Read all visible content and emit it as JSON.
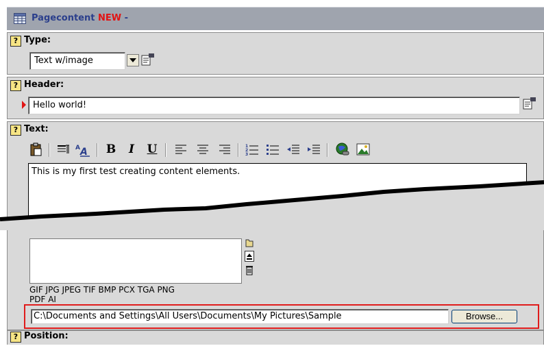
{
  "titlebar": {
    "icon": "document-table-icon",
    "title": "Pagecontent",
    "new_label": "NEW",
    "suffix": " -"
  },
  "sections": {
    "type": {
      "label": "Type:",
      "value": "Text w/image"
    },
    "header": {
      "label": "Header:",
      "value": "Hello world!"
    },
    "text": {
      "label": "Text:",
      "toolbar": [
        "paste",
        "format-block",
        "font-style",
        "bold",
        "italic",
        "underline",
        "align-left",
        "align-center",
        "align-right",
        "ordered-list",
        "unordered-list",
        "outdent",
        "indent",
        "insert-link",
        "insert-image"
      ],
      "bold_glyph": "B",
      "italic_glyph": "I",
      "underline_glyph": "U",
      "content": "This is my first test creating content elements."
    },
    "images": {
      "file_types_line1": "GIF JPG JPEG TIF BMP PCX TGA PNG",
      "file_types_line2": "PDF AI",
      "file_path": "C:\\Documents and Settings\\All Users\\Documents\\My Pictures\\Sample",
      "browse_label": "Browse..."
    },
    "position": {
      "label": "Position:"
    }
  },
  "colors": {
    "titlebar_bg": "#9fa4ae",
    "title_text": "#2b3f8c",
    "new_text": "#e11414",
    "panel_bg": "#d9d9d9",
    "highlight": "#e01b1b"
  }
}
